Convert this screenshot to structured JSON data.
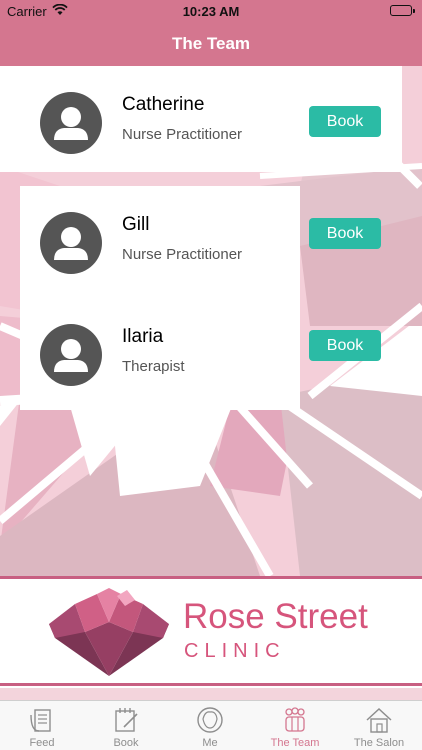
{
  "status_bar": {
    "carrier": "Carrier",
    "time": "10:23 AM"
  },
  "nav": {
    "title": "The Team"
  },
  "team": [
    {
      "name": "Catherine",
      "role": "Nurse Practitioner",
      "button": "Book"
    },
    {
      "name": "Gill",
      "role": "Nurse Practitioner",
      "button": "Book"
    },
    {
      "name": "Ilaria",
      "role": "Therapist",
      "button": "Book"
    }
  ],
  "brand": {
    "title": "Rose Street",
    "subtitle": "CLINIC"
  },
  "tabs": [
    {
      "label": "Feed",
      "icon": "feed-icon",
      "active": false
    },
    {
      "label": "Book",
      "icon": "book-icon",
      "active": false
    },
    {
      "label": "Me",
      "icon": "me-icon",
      "active": false
    },
    {
      "label": "The Team",
      "icon": "team-icon",
      "active": true
    },
    {
      "label": "The Salon",
      "icon": "salon-icon",
      "active": false
    }
  ],
  "colors": {
    "header": "#d4768f",
    "button": "#2bbba5",
    "brand": "#d6557c"
  }
}
